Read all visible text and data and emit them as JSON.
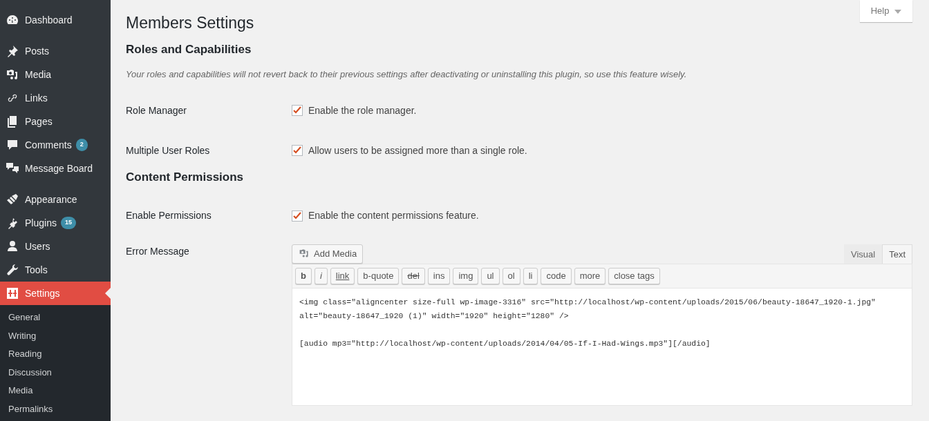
{
  "sidebar": {
    "items": [
      {
        "label": "Dashboard",
        "selected": false
      },
      {
        "label": "Posts",
        "selected": false
      },
      {
        "label": "Media",
        "selected": false
      },
      {
        "label": "Links",
        "selected": false
      },
      {
        "label": "Pages",
        "selected": false
      },
      {
        "label": "Comments",
        "badge": "2",
        "selected": false
      },
      {
        "label": "Message Board",
        "selected": false
      },
      {
        "label": "Appearance",
        "selected": false
      },
      {
        "label": "Plugins",
        "badge": "15",
        "selected": false
      },
      {
        "label": "Users",
        "selected": false
      },
      {
        "label": "Tools",
        "selected": false
      },
      {
        "label": "Settings",
        "selected": true
      }
    ],
    "submenu": [
      "General",
      "Writing",
      "Reading",
      "Discussion",
      "Media",
      "Permalinks"
    ]
  },
  "help_button": "Help",
  "title": "Members Settings",
  "sections": [
    {
      "heading": "Roles and Capabilities",
      "note": "Your roles and capabilities will not revert back to their previous settings after deactivating or uninstalling this plugin, so use this feature wisely.",
      "rows": [
        {
          "label": "Role Manager",
          "checkbox": "Enable the role manager.",
          "checked": true
        },
        {
          "label": "Multiple User Roles",
          "checkbox": "Allow users to be assigned more than a single role.",
          "checked": true
        }
      ]
    },
    {
      "heading": "Content Permissions",
      "rows": [
        {
          "label": "Enable Permissions",
          "checkbox": "Enable the content permissions feature.",
          "checked": true
        }
      ]
    }
  ],
  "editor": {
    "label": "Error Message",
    "add_media": "Add Media",
    "tabs": [
      {
        "label": "Visual",
        "selected": false
      },
      {
        "label": "Text",
        "selected": true
      }
    ],
    "toolbar": [
      "b",
      "i",
      "link",
      "b-quote",
      "del",
      "ins",
      "img",
      "ul",
      "ol",
      "li",
      "code",
      "more",
      "close tags"
    ],
    "content": "<img class=\"aligncenter size-full wp-image-3316\" src=\"http://localhost/wp-content/uploads/2015/06/beauty-18647_1920-1.jpg\" alt=\"beauty-18647_1920 (1)\" width=\"1920\" height=\"1280\" />\n\n[audio mp3=\"http://localhost/wp-content/uploads/2014/04/05-If-I-Had-Wings.mp3\"][/audio]"
  }
}
